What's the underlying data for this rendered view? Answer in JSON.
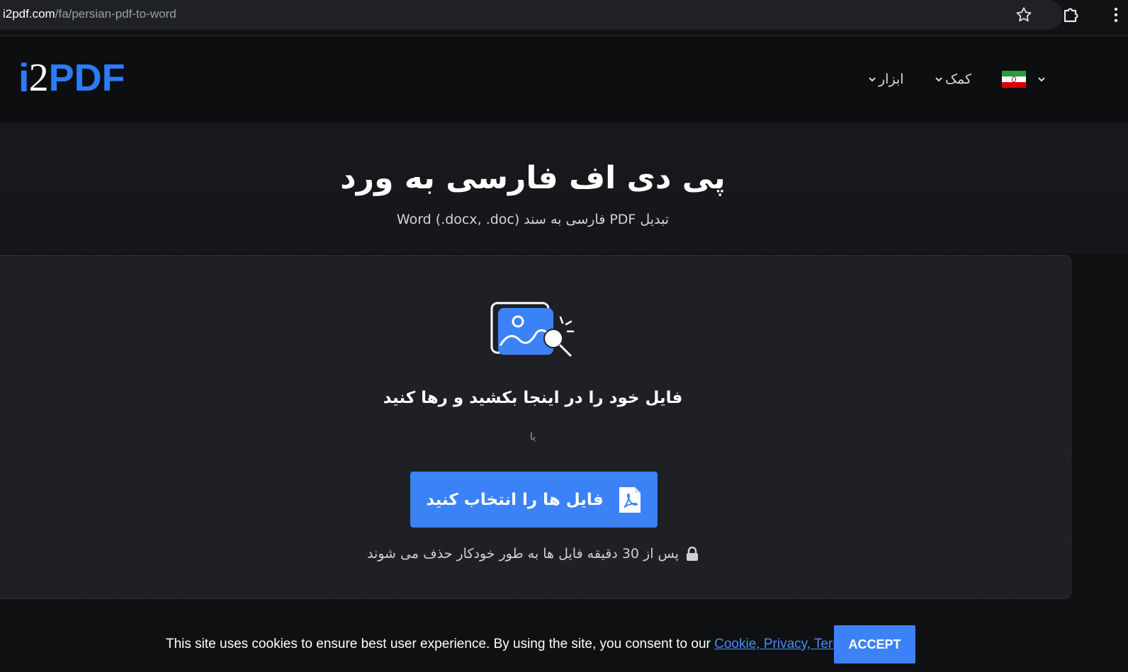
{
  "browser": {
    "url_host": "i2pdf.com",
    "url_path": "/fa/persian-pdf-to-word"
  },
  "header": {
    "logo": {
      "part1": "i",
      "part2": "2",
      "part3": "PDF"
    },
    "nav": {
      "tools_label": "ابزار",
      "help_label": "کمک"
    },
    "language_flag": "iran-flag-icon",
    "accent_color": "#2b7bff"
  },
  "hero": {
    "title": "پی دی اف فارسی به ورد",
    "subtitle": "تبدیل PDF فارسی به سند (Word (.docx, .doc"
  },
  "upload": {
    "drop_text": "فایل خود را در اینجا بکشید و رها کنید",
    "or_text": "یا",
    "choose_button_label": "فایل ها را انتخاب کنید",
    "button_color": "#3b82f6",
    "auto_delete_note": "پس از 30 دقیقه فایل ها به طور خودکار حذف می شوند"
  },
  "cookie_bar": {
    "text": "This site uses cookies to ensure best user experience. By using the site, you consent to our ",
    "link_text": "Cookie, Privacy, Terms",
    "accept_label": "ACCEPT"
  }
}
